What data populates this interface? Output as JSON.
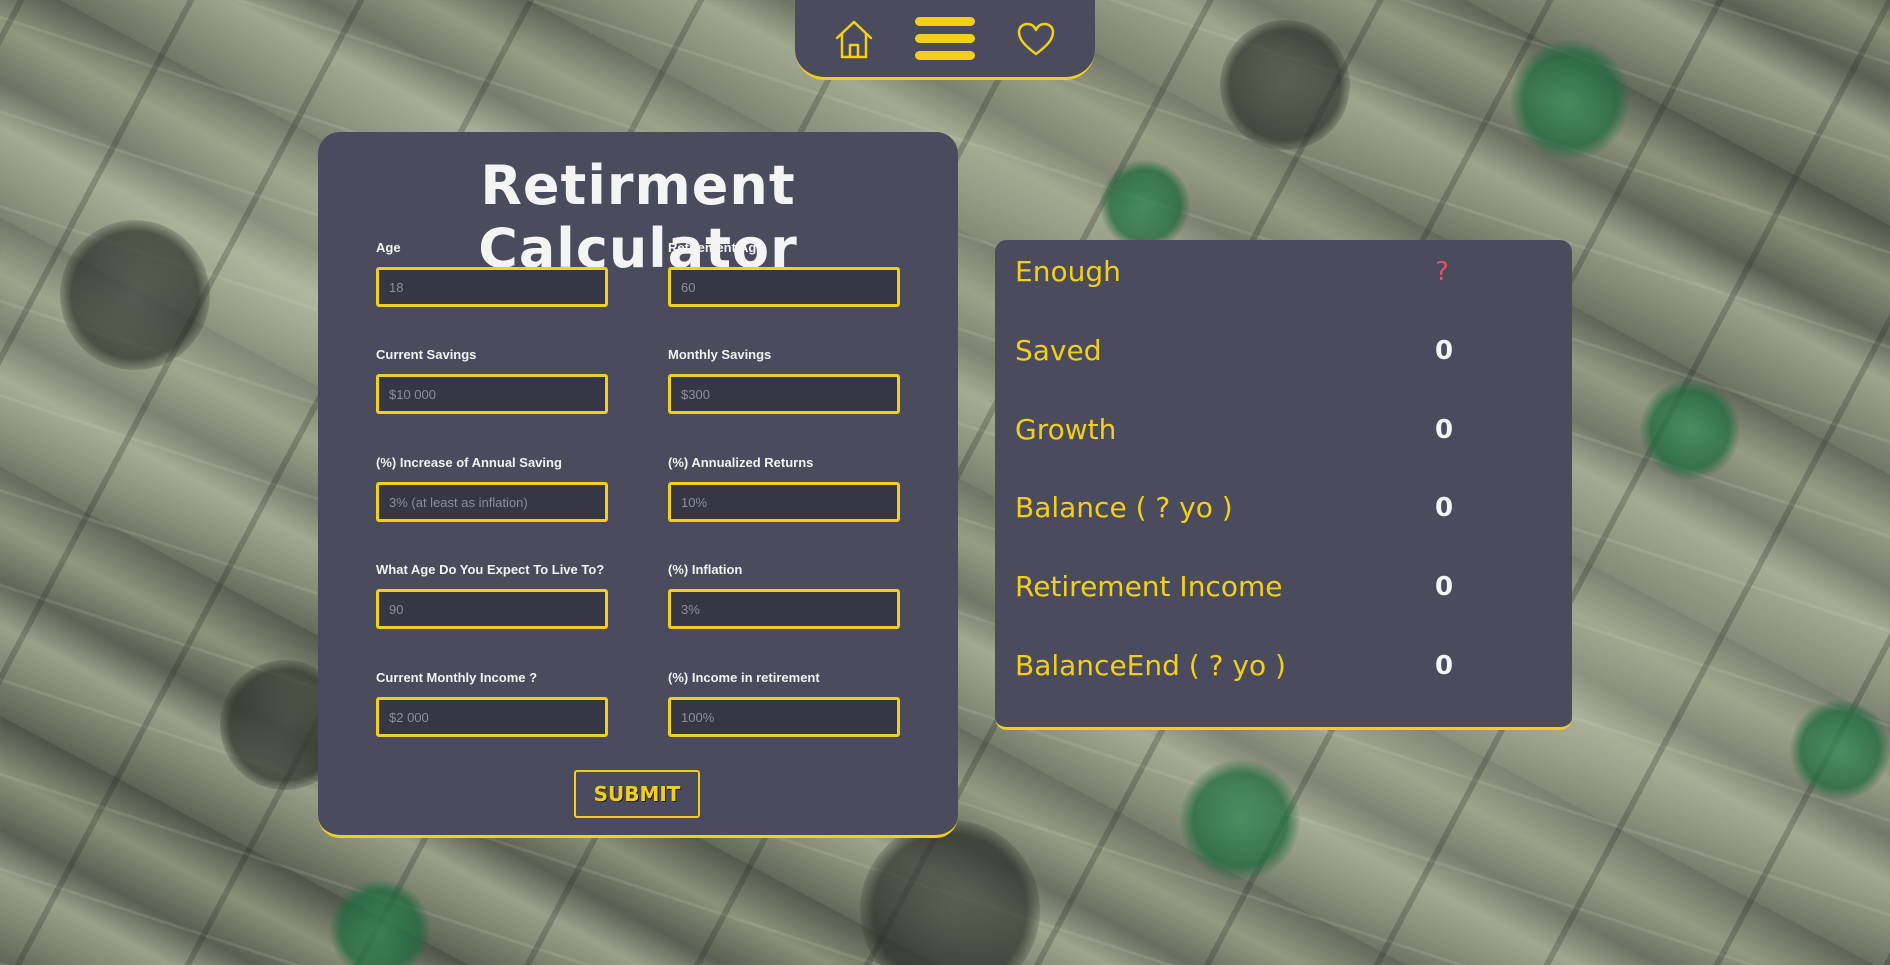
{
  "nav": {
    "home_icon": "home-icon",
    "menu_icon": "hamburger-menu-icon",
    "favorite_icon": "heart-icon",
    "accent_color": "#f2cf1a"
  },
  "form": {
    "title": "Retirment Calculator",
    "fields": [
      {
        "label": "Age",
        "placeholder": "18"
      },
      {
        "label": "Retirement Age",
        "placeholder": "60"
      },
      {
        "label": "Current Savings",
        "placeholder": "$10 000"
      },
      {
        "label": "Monthly Savings",
        "placeholder": "$300"
      },
      {
        "label": "(%) Increase of Annual Saving",
        "placeholder": "3% (at least as inflation)"
      },
      {
        "label": "(%) Annualized Returns",
        "placeholder": "10%"
      },
      {
        "label": "What Age Do You Expect To Live To?",
        "placeholder": "90"
      },
      {
        "label": "(%) Inflation",
        "placeholder": "3%"
      },
      {
        "label": "Current Monthly Income ?",
        "placeholder": "$2 000"
      },
      {
        "label": "(%) Income in retirement",
        "placeholder": "100%"
      }
    ],
    "submit_label": "SUBMIT"
  },
  "results": {
    "rows": [
      {
        "label": "Enough",
        "value": "?"
      },
      {
        "label": "Saved",
        "value": "0"
      },
      {
        "label": "Growth",
        "value": "0"
      },
      {
        "label": "Balance ( ? yo )",
        "value": "0"
      },
      {
        "label": "Retirement Income",
        "value": "0"
      },
      {
        "label": "BalanceEnd ( ? yo )",
        "value": "0"
      }
    ]
  },
  "colors": {
    "card_bg": "#4a4b5c",
    "accent": "#f2cf1a",
    "warning": "#e8505b"
  }
}
